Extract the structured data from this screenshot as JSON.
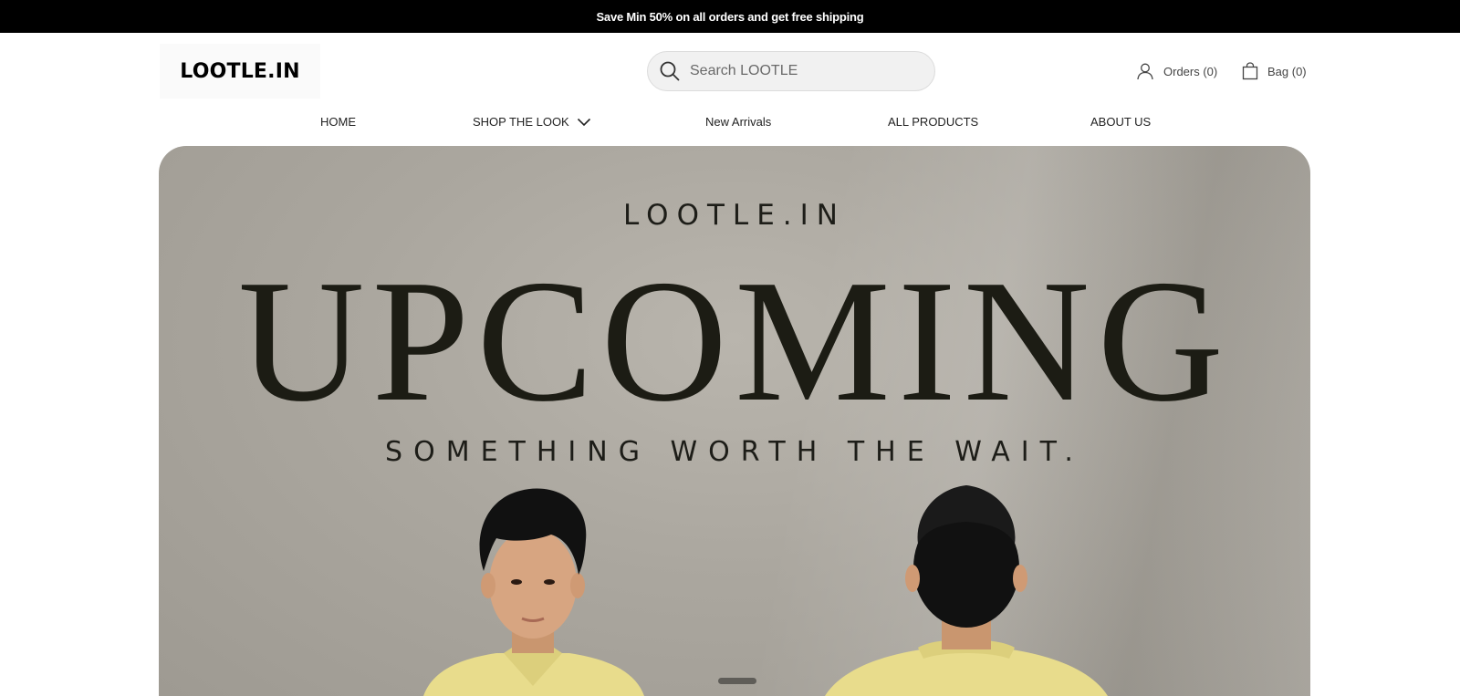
{
  "announcement": {
    "text": "Save Min 50% on all orders and get free shipping"
  },
  "header": {
    "logo_text": "LOOTLE.IN",
    "search_placeholder": "Search LOOTLE",
    "orders_label": "Orders (0)",
    "bag_label": "Bag (0)"
  },
  "nav": {
    "items": [
      {
        "label": "HOME"
      },
      {
        "label": "SHOP THE LOOK"
      },
      {
        "label": "New Arrivals"
      },
      {
        "label": "ALL PRODUCTS"
      },
      {
        "label": "ABOUT US"
      }
    ]
  },
  "hero": {
    "brand": "LOOTLE.IN",
    "headline": "UPCOMING",
    "tagline": "SOMETHING WORTH THE WAIT.",
    "shirt_color": "#e8dc8c",
    "hair_color": "#111111",
    "skin_color": "#d7a581"
  },
  "colors": {
    "announcement_bg": "#000000",
    "hero_bg": "#aba79f",
    "text_dark": "#1c1c14"
  },
  "icons": [
    "search-icon",
    "user-icon",
    "shopping-bag-icon",
    "chevron-down-icon"
  ]
}
